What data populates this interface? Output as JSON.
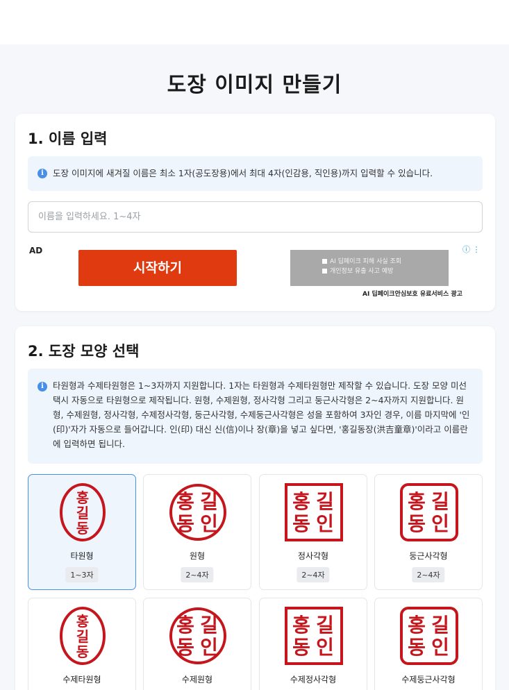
{
  "page": {
    "title": "도장 이미지 만들기"
  },
  "section1": {
    "title": "1. 이름 입력",
    "info": "도장 이미지에 새겨질 이름은 최소 1자(공도장용)에서 최대 4자(인감용, 직인용)까지 입력할 수 있습니다.",
    "input_placeholder": "이름을 입력하세요. 1~4자",
    "input_value": ""
  },
  "ad": {
    "label": "AD",
    "info_icons": "ⓘ ⋮",
    "button_label": "시작하기",
    "checkbox_1": "AI 딥페이크 피해 사실 조회",
    "checkbox_2": "개인정보 유출 사고 예방",
    "caption": "AI 딥페이크안심보호 유료서비스 광고"
  },
  "section2": {
    "title": "2. 도장 모양 선택",
    "info": "타원형과 수제타원형은 1~3자까지 지원합니다. 1자는 타원형과 수제타원형만 제작할 수 있습니다. 도장 모양 미선택시 자동으로 타원형으로 제작됩니다. 원형, 수제원형, 정사각형 그리고 둥근사각형은 2~4자까지 지원합니다. 원형, 수제원형, 정사각형, 수제정사각형, 둥근사각형, 수제둥근사각형은 성을 포함하여 3자인 경우, 이름 마지막에 '인(印)'자가 자동으로 들어갑니다. 인(印) 대신 신(信)이나 장(章)을 넣고 싶다면, '홍길동장(洪吉童章)'이라고 이름란에 입력하면 됩니다.",
    "shapes": [
      {
        "name": "타원형",
        "range": "1~3자",
        "shape": "ellipse",
        "selected": true,
        "chars": [
          "홍",
          "길",
          "동"
        ]
      },
      {
        "name": "원형",
        "range": "2~4자",
        "shape": "circle",
        "selected": false,
        "chars": [
          "홍",
          "길",
          "동",
          "인"
        ]
      },
      {
        "name": "정사각형",
        "range": "2~4자",
        "shape": "square",
        "selected": false,
        "chars": [
          "홍",
          "길",
          "동",
          "인"
        ]
      },
      {
        "name": "둥근사각형",
        "range": "2~4자",
        "shape": "rounded-square",
        "selected": false,
        "chars": [
          "홍",
          "길",
          "동",
          "인"
        ]
      },
      {
        "name": "수제타원형",
        "range": "",
        "shape": "ellipse",
        "selected": false,
        "chars": [
          "홍",
          "길",
          "동"
        ]
      },
      {
        "name": "수제원형",
        "range": "",
        "shape": "circle",
        "selected": false,
        "chars": [
          "홍",
          "길",
          "동",
          "인"
        ]
      },
      {
        "name": "수제정사각형",
        "range": "",
        "shape": "square",
        "selected": false,
        "chars": [
          "홍",
          "길",
          "동",
          "인"
        ]
      },
      {
        "name": "수제둥근사각형",
        "range": "",
        "shape": "rounded-square",
        "selected": false,
        "chars": [
          "홍",
          "길",
          "동",
          "인"
        ]
      }
    ]
  },
  "colors": {
    "stamp_red": "#c4161c",
    "accent_blue": "#4a8fe6",
    "ad_orange": "#e03a10"
  }
}
